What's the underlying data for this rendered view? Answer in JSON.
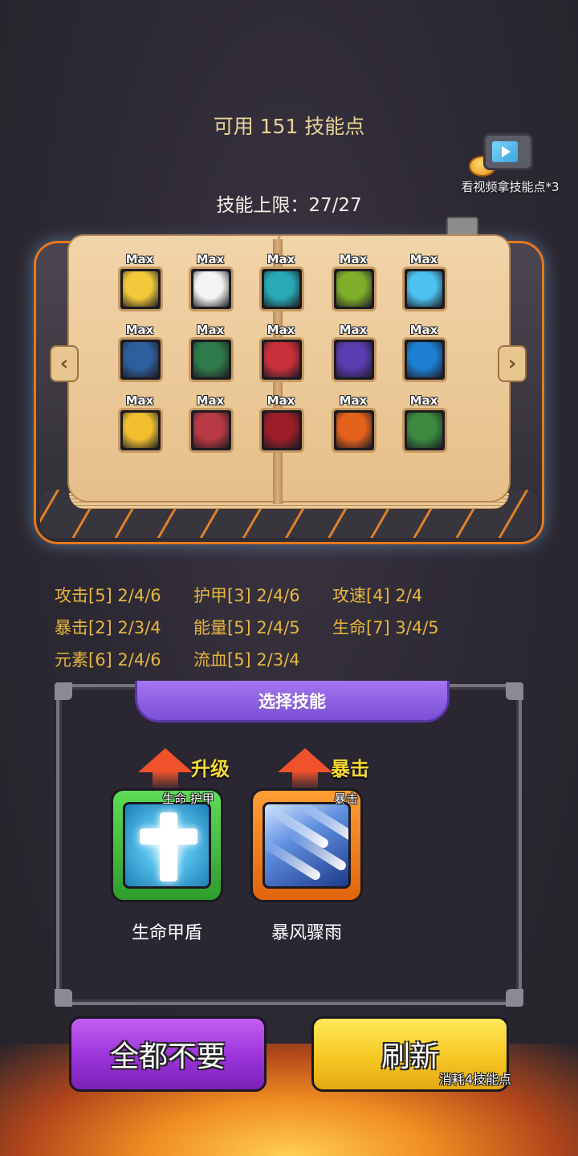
{
  "header": {
    "skill_points": "可用 151 技能点",
    "skill_limit": "技能上限：27/27"
  },
  "video_reward": {
    "label": "看视频拿技能点*3",
    "icon": "tv-icon"
  },
  "book": {
    "max_label": "Max",
    "rows": [
      [
        {
          "icon": "duck-icon",
          "color": "#f2c93a"
        },
        {
          "icon": "vortex-icon",
          "color": "#f4f4f4"
        },
        {
          "icon": "ghost-figure-icon",
          "color": "#27a9b6"
        },
        {
          "icon": "poison-swamp-icon",
          "color": "#7fae2b"
        },
        {
          "icon": "shark-fin-icon",
          "color": "#4bc2ef"
        }
      ],
      [
        {
          "icon": "starry-water-icon",
          "color": "#2e5f9c"
        },
        {
          "icon": "thorn-roots-icon",
          "color": "#2f7a4a"
        },
        {
          "icon": "shark-head-icon",
          "color": "#c9303a"
        },
        {
          "icon": "sleeping-blob-icon",
          "color": "#5a3bb0"
        },
        {
          "icon": "water-ripple-icon",
          "color": "#1c7fd2"
        }
      ],
      [
        {
          "icon": "dice-icon",
          "color": "#f2c02f"
        },
        {
          "icon": "grinning-monster-icon",
          "color": "#b83a44"
        },
        {
          "icon": "red-cloak-icon",
          "color": "#9c1e29"
        },
        {
          "icon": "fire-aura-icon",
          "color": "#e5621d"
        },
        {
          "icon": "forest-spirit-icon",
          "color": "#3b8a3e"
        }
      ]
    ]
  },
  "stats": [
    "攻击[5] 2/4/6",
    "护甲[3] 2/4/6",
    "攻速[4] 2/4",
    "暴击[2] 2/3/4",
    "能量[5] 2/4/5",
    "生命[7] 3/4/5",
    "元素[6] 2/4/6",
    "流血[5] 2/3/4"
  ],
  "select_panel": {
    "title": "选择技能",
    "choices": [
      {
        "badge": "升级",
        "tags": "生命 护甲",
        "name": "生命甲盾",
        "icon": "holy-cross-icon",
        "frame_color": "#3fbf3b"
      },
      {
        "badge": "暴击",
        "tags": "暴击",
        "name": "暴风骤雨",
        "icon": "meteor-shower-icon",
        "frame_color": "#f47c1b"
      }
    ]
  },
  "buttons": {
    "discard_all": "全都不要",
    "refresh": "刷新",
    "refresh_cost": "消耗4技能点"
  }
}
